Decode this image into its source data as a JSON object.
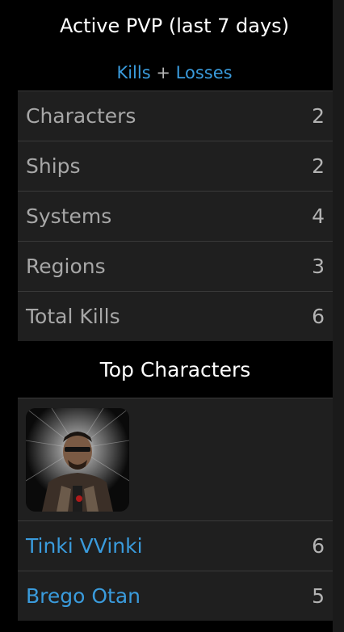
{
  "title": "Active PVP (last 7 days)",
  "subtitle": {
    "kills": "Kills",
    "plus": "+",
    "losses": "Losses"
  },
  "stats": [
    {
      "label": "Characters",
      "value": "2"
    },
    {
      "label": "Ships",
      "value": "2"
    },
    {
      "label": "Systems",
      "value": "4"
    },
    {
      "label": "Regions",
      "value": "3"
    },
    {
      "label": "Total Kills",
      "value": "6"
    }
  ],
  "top_characters": {
    "heading": "Top Characters",
    "rows": [
      {
        "name": "Tinki VVinki",
        "value": "6"
      },
      {
        "name": "Brego Otan",
        "value": "5"
      }
    ]
  },
  "colors": {
    "link": "#3a9bdc",
    "panel": "#1f1f1f",
    "background": "#000000"
  }
}
